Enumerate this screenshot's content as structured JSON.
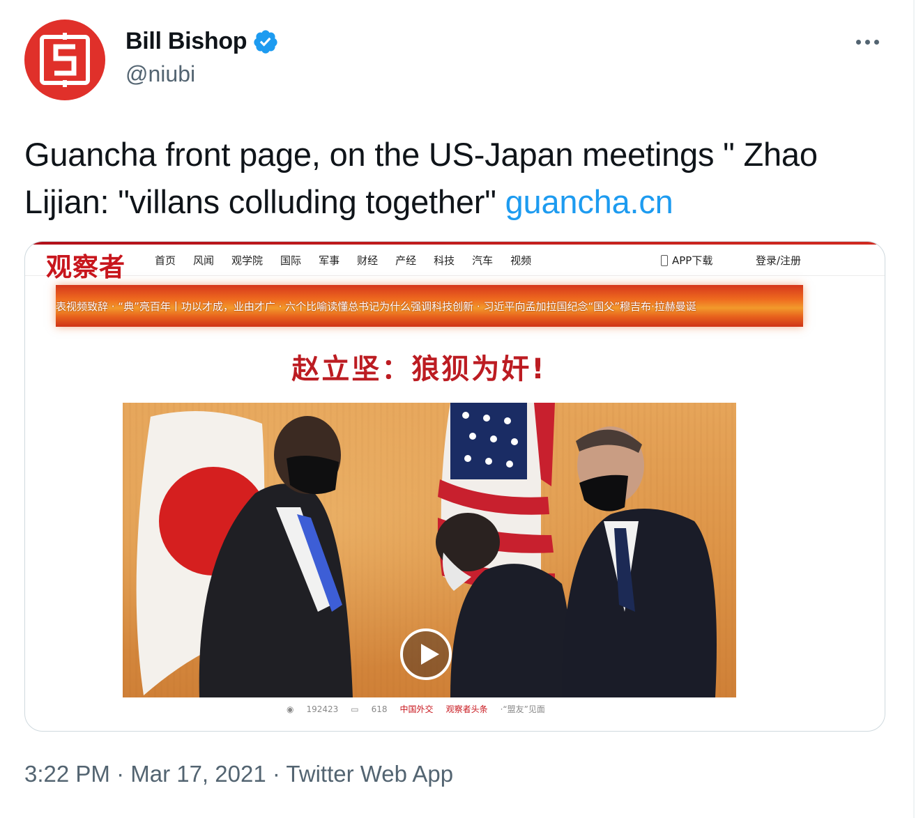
{
  "author": {
    "display_name": "Bill Bishop",
    "handle": "@niubi"
  },
  "tweet": {
    "text": "Guancha front page, on the US-Japan meetings \" Zhao Lijian: \"villans colluding together\" ",
    "link_text": "guancha.cn"
  },
  "media": {
    "site": {
      "logo": "观察者",
      "nav": [
        "首页",
        "风闻",
        "观学院",
        "国际",
        "军事",
        "财经",
        "产经",
        "科技",
        "汽车",
        "视频"
      ],
      "app_download": "APP下载",
      "login": "登录/注册"
    },
    "ticker": "表视频致辞  ·  “典”亮百年丨功以才成，业由才广  ·  六个比喻读懂总书记为什么强调科技创新  ·  习近平向孟加拉国纪念“国父”穆吉布·拉赫曼诞",
    "headline": "赵立坚：狼狈为奸!",
    "meta": {
      "views": "192423",
      "comments": "618",
      "tag1": "中国外交",
      "tag2": "观察者头条",
      "related": "·“盟友”见面"
    }
  },
  "timestamp": "3:22 PM · Mar 17, 2021 · Twitter Web App",
  "colors": {
    "accent": "#1d9bf0",
    "avatar_red": "#e0302a",
    "guancha_red": "#c8161d"
  },
  "icons": [
    "verified-badge-icon",
    "more-options-icon",
    "phone-icon",
    "eye-icon",
    "comment-icon",
    "play-icon"
  ]
}
